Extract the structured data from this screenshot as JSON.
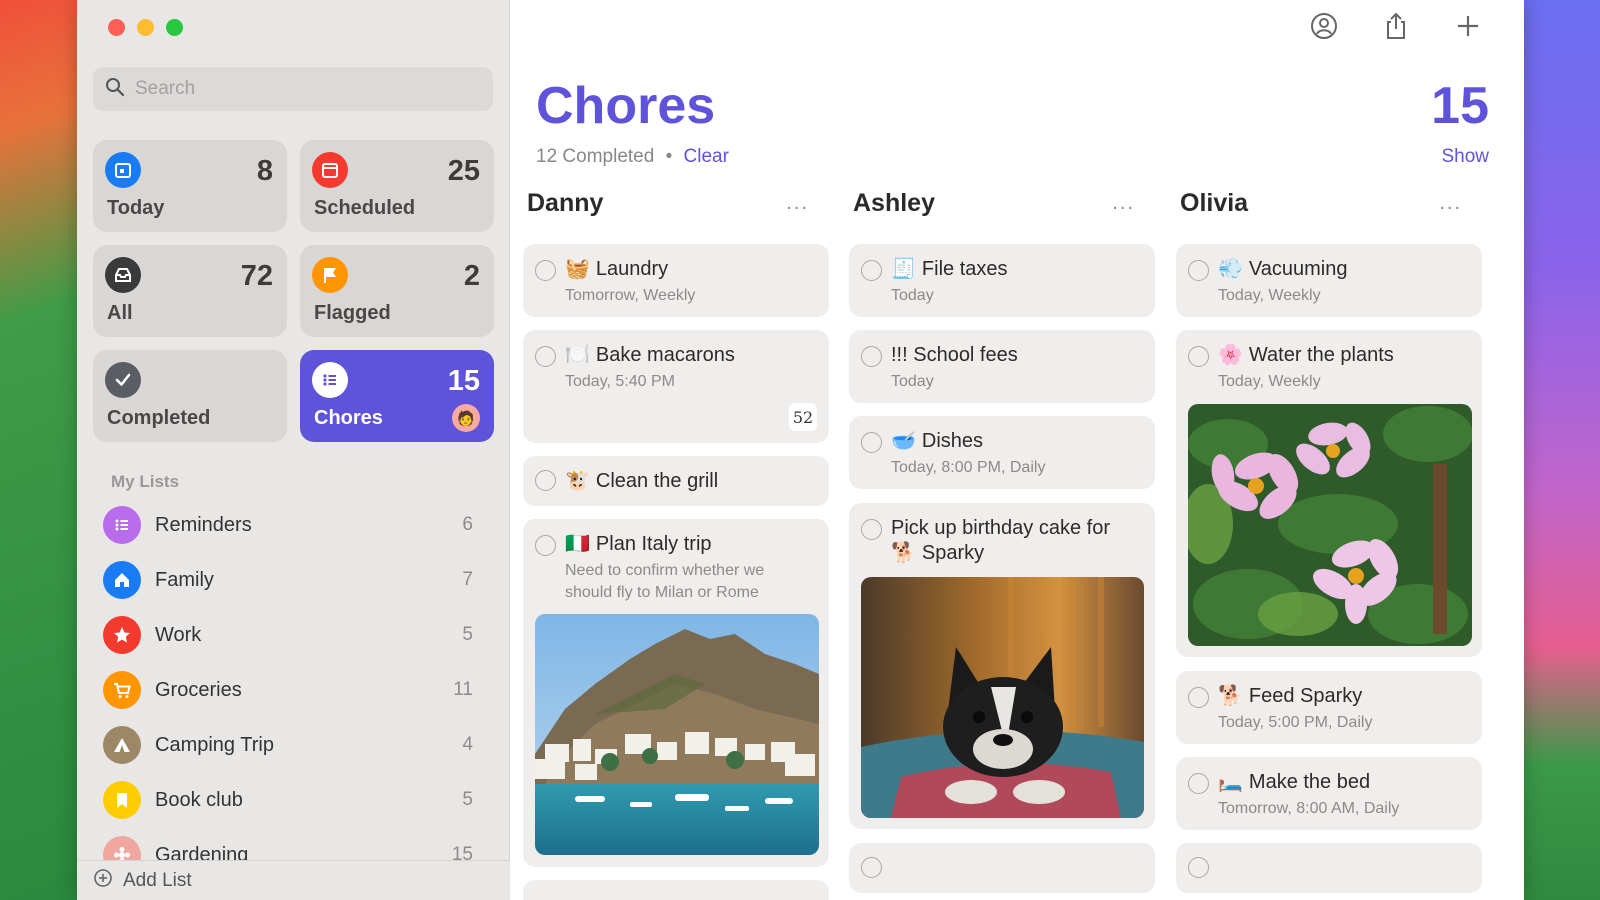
{
  "sidebar": {
    "search_placeholder": "Search",
    "smart_lists": [
      {
        "label": "Today",
        "count": "8",
        "color": "#1a7cf5"
      },
      {
        "label": "Scheduled",
        "count": "25",
        "color": "#f23a2f"
      },
      {
        "label": "All",
        "count": "72",
        "color": "#3a3a3c"
      },
      {
        "label": "Flagged",
        "count": "2",
        "color": "#ff9500"
      },
      {
        "label": "Completed",
        "count": "",
        "color": "#5a5d63"
      },
      {
        "label": "Chores",
        "count": "15",
        "color": "#5f54d9"
      }
    ],
    "my_lists_title": "My Lists",
    "lists": [
      {
        "name": "Reminders",
        "count": "6",
        "color": "#b86bea"
      },
      {
        "name": "Family",
        "count": "7",
        "color": "#1a7cf5"
      },
      {
        "name": "Work",
        "count": "5",
        "color": "#f23a2f"
      },
      {
        "name": "Groceries",
        "count": "11",
        "color": "#ff9500"
      },
      {
        "name": "Camping Trip",
        "count": "4",
        "color": "#9c8867"
      },
      {
        "name": "Book club",
        "count": "5",
        "color": "#ffcc00"
      },
      {
        "name": "Gardening",
        "count": "15",
        "color": "#f0a7a0"
      }
    ],
    "add_list": "Add List"
  },
  "main": {
    "title": "Chores",
    "total": "15",
    "completed_text": "12 Completed",
    "separator": "•",
    "clear": "Clear",
    "show": "Show",
    "more": "...",
    "columns": [
      {
        "name": "Danny",
        "cards": [
          {
            "emoji": "🧺",
            "title": "Laundry",
            "subtitle": "Tomorrow, Weekly"
          },
          {
            "emoji": "🍽️",
            "title": "Bake macarons",
            "subtitle": "Today, 5:40 PM",
            "badge": "52"
          },
          {
            "emoji": "🐮",
            "title": "Clean the grill",
            "subtitle": ""
          },
          {
            "emoji": "🇮🇹",
            "title": "Plan Italy trip",
            "subtitle": "Need to confirm whether we should fly to Milan or Rome"
          }
        ]
      },
      {
        "name": "Ashley",
        "cards": [
          {
            "emoji": "🧾",
            "title": "File taxes",
            "subtitle": "Today"
          },
          {
            "emoji": "",
            "title": "!!! School fees",
            "subtitle": "Today"
          },
          {
            "emoji": "🥣",
            "title": "Dishes",
            "subtitle": "Today, 8:00 PM, Daily"
          },
          {
            "emoji": "🐕",
            "title": "Pick up birthday cake for",
            "title2": "Sparky",
            "subtitle": ""
          }
        ]
      },
      {
        "name": "Olivia",
        "cards": [
          {
            "emoji": "💨",
            "title": "Vacuuming",
            "subtitle": "Today, Weekly"
          },
          {
            "emoji": "🌸",
            "title": "Water the plants",
            "subtitle": "Today, Weekly"
          },
          {
            "emoji": "🐕",
            "title": "Feed Sparky",
            "subtitle": "Today, 5:00 PM, Daily"
          },
          {
            "emoji": "🛏️",
            "title": "Make the bed",
            "subtitle": "Tomorrow, 8:00 AM, Daily"
          }
        ]
      }
    ]
  }
}
